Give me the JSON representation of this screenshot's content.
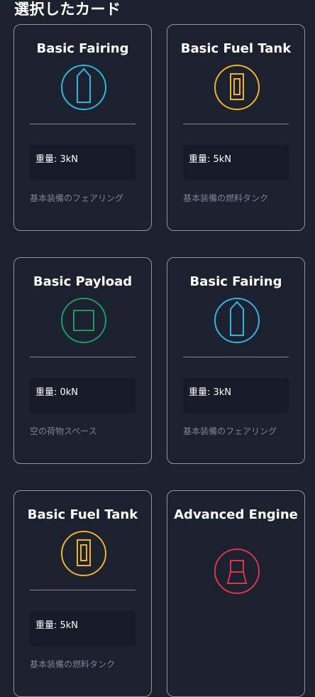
{
  "page": {
    "title": "選択したカード"
  },
  "cards": [
    {
      "name": "Basic Fairing",
      "icon": "fairing-icon",
      "color": "#2ab8e0",
      "weight_label": "重量: 3kN",
      "description": "基本装備のフェアリング"
    },
    {
      "name": "Basic Fuel Tank",
      "icon": "fuel-tank-icon",
      "color": "#f0b323",
      "weight_label": "重量: 5kN",
      "description": "基本装備の燃料タンク"
    },
    {
      "name": "Basic Payload",
      "icon": "payload-icon",
      "color": "#1f9c5c",
      "weight_label": "重量: 0kN",
      "description": "空の荷物スペース"
    },
    {
      "name": "Basic Fairing",
      "icon": "fairing-icon",
      "color": "#2ab8e0",
      "weight_label": "重量: 3kN",
      "description": "基本装備のフェアリング"
    },
    {
      "name": "Basic Fuel Tank",
      "icon": "fuel-tank-icon",
      "color": "#f0b323",
      "weight_label": "重量: 5kN",
      "description": "基本装備の燃料タンク"
    },
    {
      "name": "Advanced Engine",
      "icon": "engine-icon",
      "color": "#e0334a",
      "weight_label": "",
      "description": ""
    }
  ]
}
